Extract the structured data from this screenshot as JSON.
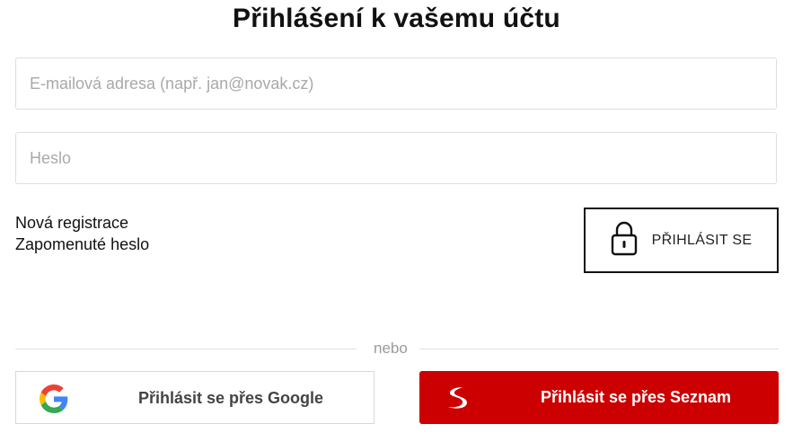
{
  "title": "Přihlášení k vašemu účtu",
  "form": {
    "email_placeholder": "E-mailová adresa (např. jan@novak.cz)",
    "email_value": "",
    "password_placeholder": "Heslo",
    "password_value": ""
  },
  "links": {
    "register": "Nová registrace",
    "forgot": "Zapomenuté heslo"
  },
  "login_button": {
    "label": "PŘIHLÁSIT SE",
    "icon": "lock-icon"
  },
  "divider_text": "nebo",
  "social": {
    "google": {
      "label": "Přihlásit se přes Google",
      "icon": "google-icon"
    },
    "seznam": {
      "label": "Přihlásit se přes Seznam",
      "icon": "seznam-icon",
      "color": "#cc0000"
    }
  }
}
